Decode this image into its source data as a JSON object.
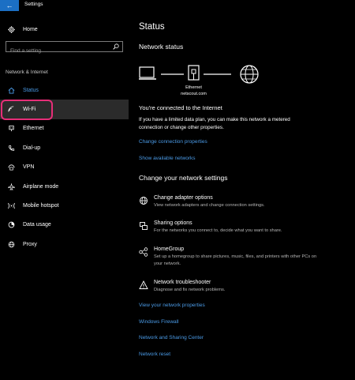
{
  "window": {
    "title": "Settings",
    "back_glyph": "←"
  },
  "sidebar": {
    "home_label": "Home",
    "search_placeholder": "Find a setting",
    "section_label": "Network & Internet",
    "items": [
      {
        "label": "Status",
        "icon": "home-globe-icon"
      },
      {
        "label": "Wi-Fi",
        "icon": "wifi-icon"
      },
      {
        "label": "Ethernet",
        "icon": "ethernet-icon"
      },
      {
        "label": "Dial-up",
        "icon": "phone-icon"
      },
      {
        "label": "VPN",
        "icon": "vpn-icon"
      },
      {
        "label": "Airplane mode",
        "icon": "airplane-icon"
      },
      {
        "label": "Mobile hotspot",
        "icon": "hotspot-icon"
      },
      {
        "label": "Data usage",
        "icon": "data-usage-icon"
      },
      {
        "label": "Proxy",
        "icon": "globe-icon"
      }
    ]
  },
  "main": {
    "title": "Status",
    "network_status_heading": "Network status",
    "diagram": {
      "adapter_label": "Ethernet",
      "network_label": "netscout.com"
    },
    "connected_title": "You're connected to the Internet",
    "connected_desc": "If you have a limited data plan, you can make this network a metered connection or change other properties.",
    "links_top": [
      "Change connection properties",
      "Show available networks"
    ],
    "change_heading": "Change your network settings",
    "options": [
      {
        "title": "Change adapter options",
        "desc": "View network adapters and change connection settings.",
        "icon": "adapter-icon"
      },
      {
        "title": "Sharing options",
        "desc": "For the networks you connect to, decide what you want to share.",
        "icon": "sharing-icon"
      },
      {
        "title": "HomeGroup",
        "desc": "Set up a homegroup to share pictures, music, files, and printers with other PCs on your network.",
        "icon": "homegroup-icon"
      },
      {
        "title": "Network troubleshooter",
        "desc": "Diagnose and fix network problems.",
        "icon": "warning-icon"
      }
    ],
    "links_bottom": [
      "View your network properties",
      "Windows Firewall",
      "Network and Sharing Center",
      "Network reset"
    ]
  },
  "colors": {
    "accent": "#4a9ae6",
    "highlight_ring": "#e62e78",
    "back_button": "#1b6fc4"
  }
}
